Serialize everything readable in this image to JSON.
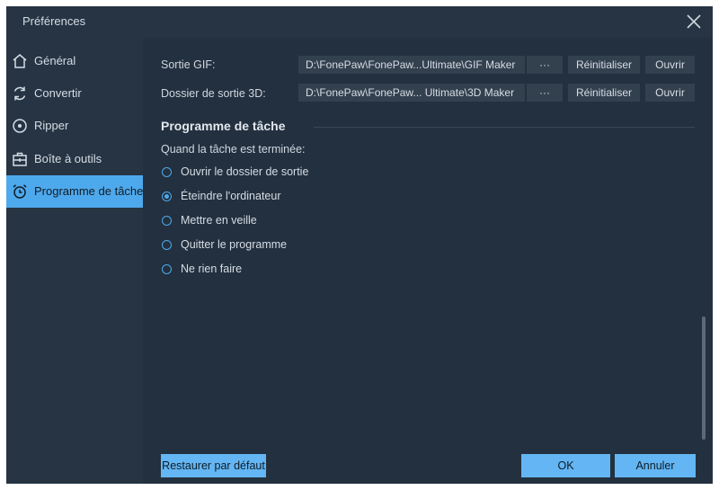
{
  "window": {
    "title": "Préférences"
  },
  "sidebar": {
    "items": [
      {
        "label": "Général",
        "icon": "home-icon"
      },
      {
        "label": "Convertir",
        "icon": "convert-icon"
      },
      {
        "label": "Ripper",
        "icon": "disc-icon"
      },
      {
        "label": "Boîte à outils",
        "icon": "toolbox-icon"
      },
      {
        "label": "Programme de tâche",
        "icon": "alarm-clock-icon",
        "active": true
      }
    ]
  },
  "output": {
    "rows": [
      {
        "label": "Sortie GIF:",
        "path": "D:\\FonePaw\\FonePaw...Ultimate\\GIF Maker",
        "browse": "···",
        "reset": "Réinitialiser",
        "open": "Ouvrir"
      },
      {
        "label": "Dossier de sortie 3D:",
        "path": "D:\\FonePaw\\FonePaw... Ultimate\\3D Maker",
        "browse": "···",
        "reset": "Réinitialiser",
        "open": "Ouvrir"
      }
    ]
  },
  "schedule": {
    "title": "Programme de tâche",
    "question": "Quand la tâche est terminée:",
    "options": [
      {
        "label": "Ouvrir le dossier de sortie",
        "checked": false
      },
      {
        "label": "Éteindre l'ordinateur",
        "checked": true
      },
      {
        "label": "Mettre en veille",
        "checked": false
      },
      {
        "label": "Quitter le programme",
        "checked": false
      },
      {
        "label": "Ne rien faire",
        "checked": false
      }
    ]
  },
  "footer": {
    "restore": "Restaurer par défaut",
    "ok": "OK",
    "cancel": "Annuler"
  },
  "colors": {
    "accent": "#4ea9ec",
    "background": "#23303f",
    "sidebar": "#263443",
    "button": "#63b6f3"
  }
}
